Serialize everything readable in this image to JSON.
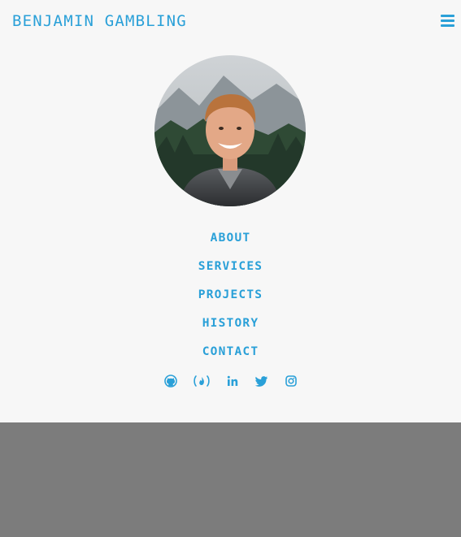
{
  "brand": "BENJAMIN GAMBLING",
  "colors": {
    "accent": "#2aa0d8",
    "background": "#f7f7f7",
    "overlay": "#7c7c7c"
  },
  "menu_toggle_icon": "bars-icon",
  "avatar_alt": "Portrait of Benjamin Gambling",
  "menu": [
    {
      "label": "ABOUT"
    },
    {
      "label": "SERVICES"
    },
    {
      "label": "PROJECTS"
    },
    {
      "label": "HISTORY"
    },
    {
      "label": "CONTACT"
    }
  ],
  "socials": [
    {
      "icon": "github-icon"
    },
    {
      "icon": "freecodecamp-icon"
    },
    {
      "icon": "linkedin-icon"
    },
    {
      "icon": "twitter-icon"
    },
    {
      "icon": "instagram-icon"
    }
  ]
}
